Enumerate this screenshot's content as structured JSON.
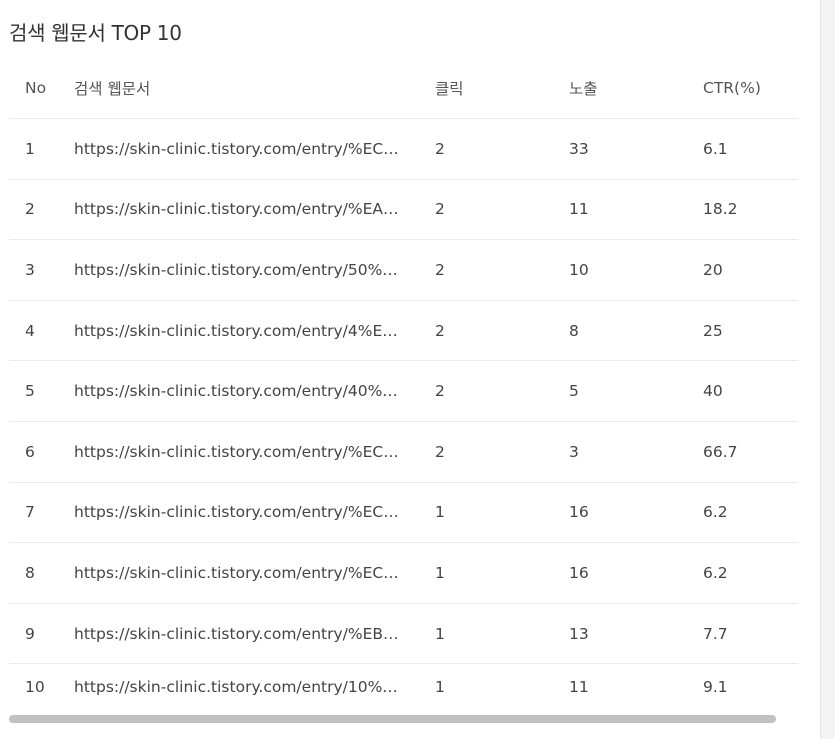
{
  "title": "검색 웹문서 TOP 10",
  "columns": {
    "no": "No",
    "url": "검색 웹문서",
    "clicks": "클릭",
    "impressions": "노출",
    "ctr": "CTR(%)"
  },
  "rows": [
    {
      "no": "1",
      "url": "https://skin-clinic.tistory.com/entry/%EC…",
      "clicks": "2",
      "impressions": "33",
      "ctr": "6.1"
    },
    {
      "no": "2",
      "url": "https://skin-clinic.tistory.com/entry/%EA…",
      "clicks": "2",
      "impressions": "11",
      "ctr": "18.2"
    },
    {
      "no": "3",
      "url": "https://skin-clinic.tistory.com/entry/50%…",
      "clicks": "2",
      "impressions": "10",
      "ctr": "20"
    },
    {
      "no": "4",
      "url": "https://skin-clinic.tistory.com/entry/4%E…",
      "clicks": "2",
      "impressions": "8",
      "ctr": "25"
    },
    {
      "no": "5",
      "url": "https://skin-clinic.tistory.com/entry/40%…",
      "clicks": "2",
      "impressions": "5",
      "ctr": "40"
    },
    {
      "no": "6",
      "url": "https://skin-clinic.tistory.com/entry/%EC…",
      "clicks": "2",
      "impressions": "3",
      "ctr": "66.7"
    },
    {
      "no": "7",
      "url": "https://skin-clinic.tistory.com/entry/%EC…",
      "clicks": "1",
      "impressions": "16",
      "ctr": "6.2"
    },
    {
      "no": "8",
      "url": "https://skin-clinic.tistory.com/entry/%EC…",
      "clicks": "1",
      "impressions": "16",
      "ctr": "6.2"
    },
    {
      "no": "9",
      "url": "https://skin-clinic.tistory.com/entry/%EB…",
      "clicks": "1",
      "impressions": "13",
      "ctr": "7.7"
    },
    {
      "no": "10",
      "url": "https://skin-clinic.tistory.com/entry/10%…",
      "clicks": "1",
      "impressions": "11",
      "ctr": "9.1"
    }
  ],
  "scrollbar": {
    "thumb_color": "#c1c1c1"
  }
}
